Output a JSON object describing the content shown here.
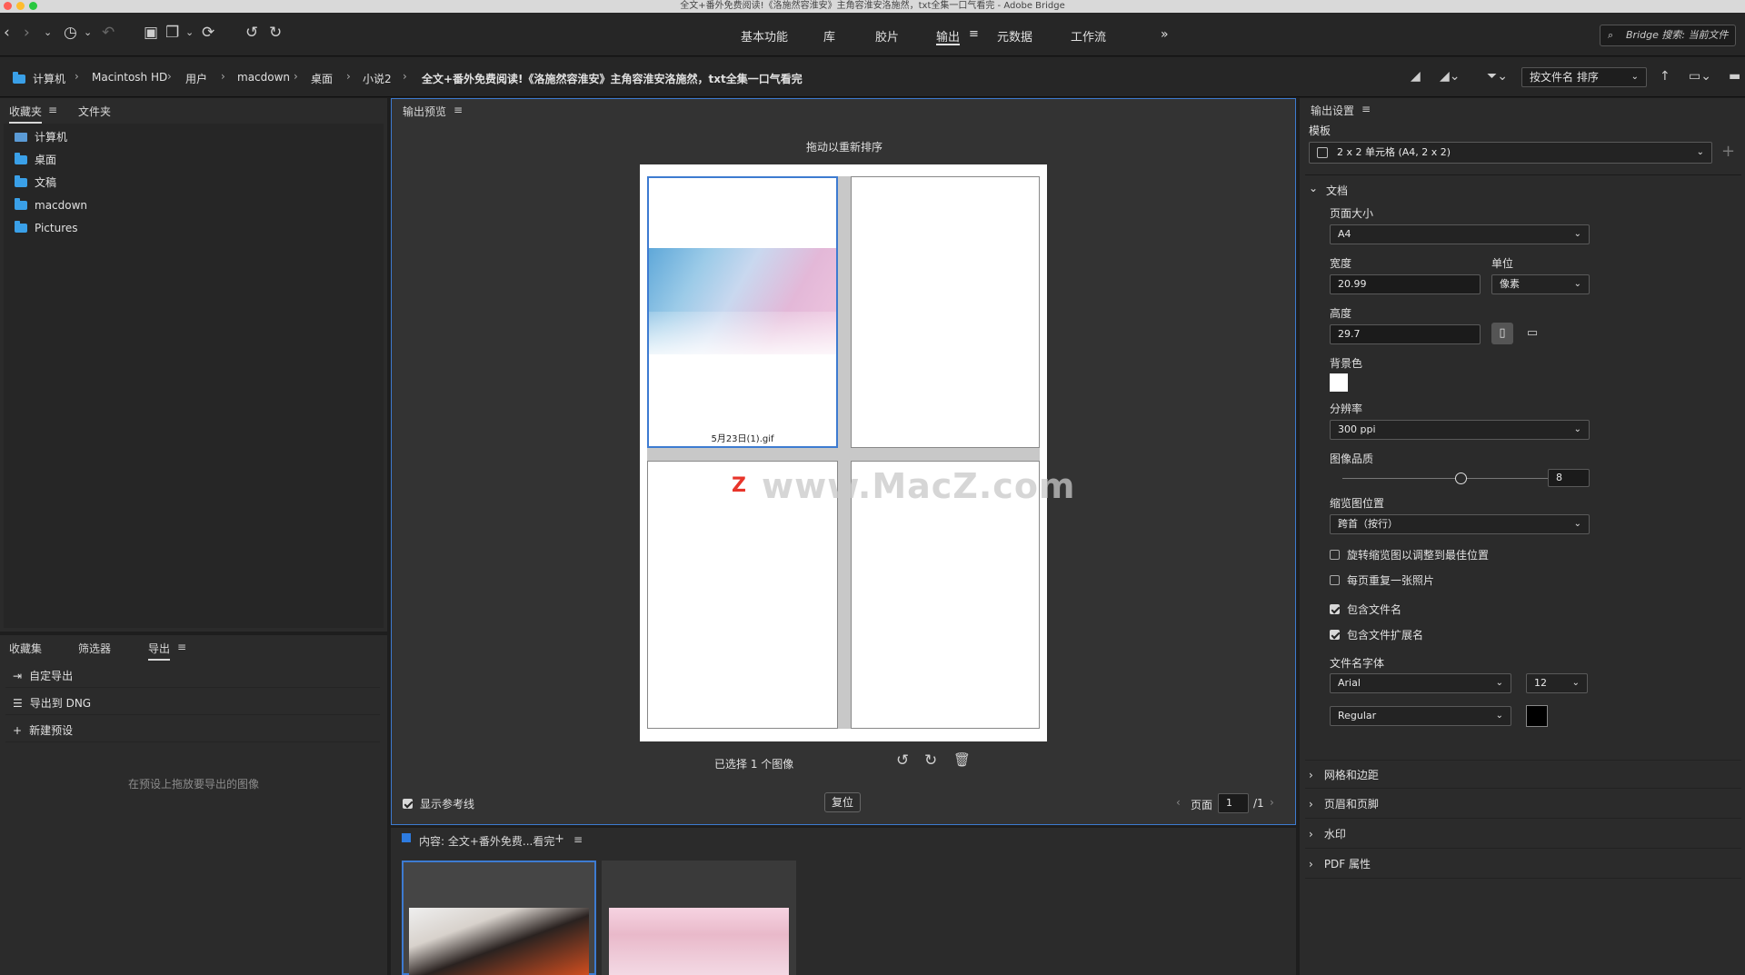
{
  "window": {
    "title": "全文+番外免费阅读!《洛施然容淮安》主角容淮安洛施然，txt全集一口气看完 - Adobe Bridge"
  },
  "toolbar": {
    "workspaces": [
      "基本功能",
      "库",
      "胶片",
      "输出",
      "元数据",
      "工作流"
    ],
    "active_workspace": "输出",
    "more_label": "»",
    "search_placeholder": "Bridge 搜索: 当前文件"
  },
  "path": {
    "crumbs": [
      "计算机",
      "Macintosh HD",
      "用户",
      "macdown",
      "桌面",
      "小说2",
      "全文+番外免费阅读!《洛施然容淮安》主角容淮安洛施然，txt全集一口气看完"
    ],
    "sort_label": "按文件名 排序"
  },
  "favorites": {
    "tabs": [
      "收藏夹",
      "文件夹"
    ],
    "items": [
      "计算机",
      "桌面",
      "文稿",
      "macdown",
      "Pictures"
    ]
  },
  "export_panel": {
    "tabs": [
      "收藏集",
      "筛选器",
      "导出"
    ],
    "items": [
      "自定导出",
      "导出到 DNG",
      "新建预设"
    ],
    "hint": "在预设上拖放要导出的图像"
  },
  "preview": {
    "title": "输出预览",
    "drag_hint": "拖动以重新排序",
    "cell_caption": "5月23日(1).gif",
    "watermark": "www.MacZ.com",
    "selected_count": "已选择 1 个图像",
    "show_guides_label": "显示参考线",
    "reset_label": "复位",
    "page_label": "页面",
    "page_current": "1",
    "page_total": "/1"
  },
  "content": {
    "title": "内容: 全文+番外免费...看完",
    "add_label": "+"
  },
  "output_settings": {
    "title": "输出设置",
    "template_label": "模板",
    "template_value": "2 x 2 单元格 (A4, 2 x 2)",
    "document_label": "文档",
    "page_size_label": "页面大小",
    "page_size_value": "A4",
    "width_label": "宽度",
    "width_value": "20.99",
    "unit_label": "单位",
    "unit_value": "像素",
    "height_label": "高度",
    "height_value": "29.7",
    "bg_label": "背景色",
    "resolution_label": "分辨率",
    "resolution_value": "300 ppi",
    "quality_label": "图像品质",
    "quality_value": "8",
    "thumb_pos_label": "缩览图位置",
    "thumb_pos_value": "跨首（按行）",
    "checks": [
      {
        "label": "旋转缩览图以调整到最佳位置",
        "checked": false
      },
      {
        "label": "每页重复一张照片",
        "checked": false
      },
      {
        "label": "包含文件名",
        "checked": true
      },
      {
        "label": "包含文件扩展名",
        "checked": true
      }
    ],
    "font_label": "文件名字体",
    "font_value": "Arial",
    "font_size_value": "12",
    "font_style_value": "Regular",
    "sections": [
      "网格和边距",
      "页眉和页脚",
      "水印",
      "PDF 属性"
    ],
    "colors": {
      "bg_swatch": "#ffffff",
      "font_swatch": "#000000",
      "accent": "#3d7bd1"
    }
  }
}
